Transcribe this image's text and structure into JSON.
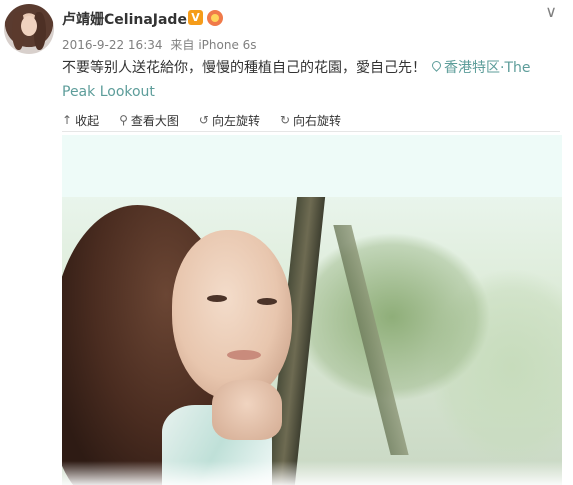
{
  "post": {
    "nickname": "卢靖姗CelinaJade",
    "verified_badge": "V",
    "timestamp": "2016-9-22 16:34",
    "source_prefix": "来自",
    "source": "iPhone 6s",
    "text": "不要等别人送花給你，慢慢的種植自己的花園，愛自己先！",
    "location": "香港特区·The Peak Lookout",
    "menu_icon": "chevron-down-icon"
  },
  "toolbar": {
    "collapse_label": "收起",
    "view_large_label": "查看大图",
    "rotate_left_label": "向左旋转",
    "rotate_right_label": "向右旋转"
  },
  "colors": {
    "accent": "#5d9d9a",
    "verified": "#f59c1a",
    "meta_text": "#808080",
    "body_text": "#333333"
  }
}
